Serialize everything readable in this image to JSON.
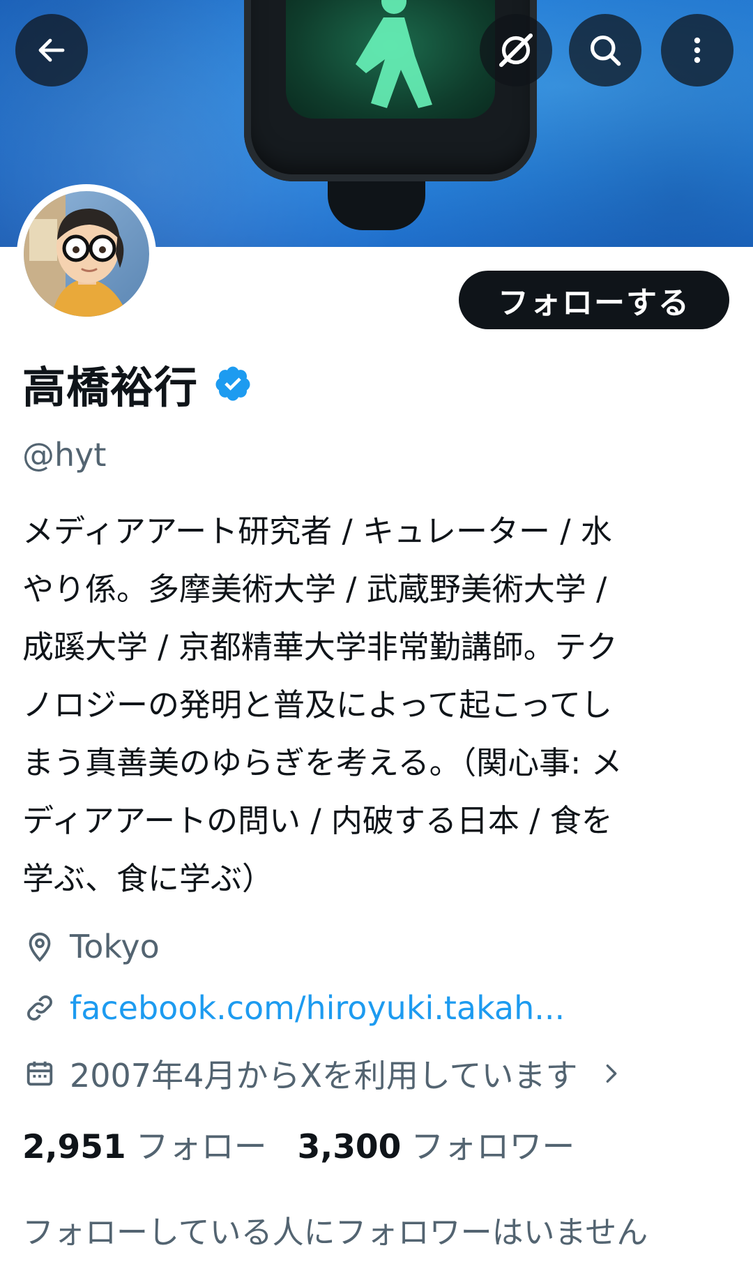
{
  "header": {
    "back_icon": "arrow-left-icon",
    "grok_icon": "grok-icon",
    "search_icon": "search-icon",
    "more_icon": "more-vertical-icon"
  },
  "profile": {
    "name": "高橋裕行",
    "handle": "@hyt",
    "verified": true,
    "follow_label": "フォローする",
    "bio_lines": [
      "メディアアート研究者 / キュレーター /  水",
      "やり係。多摩美術大学 / 武蔵野美術大学 /",
      "成蹊大学 / 京都精華大学非常勤講師。テク",
      "ノロジーの発明と普及によって起こってし",
      "まう真善美のゆらぎを考える。（関心事: メ",
      "ディアアートの問い  / 内破する日本 / 食を",
      "学ぶ、食に学ぶ）"
    ],
    "location": "Tokyo",
    "website": "facebook.com/hiroyuki.takah...",
    "joined": "2007年4月からXを利用しています",
    "following_count": "2,951",
    "following_label": "フォロー",
    "followers_count": "3,300",
    "followers_label": "フォロワー",
    "mutual_note": "フォローしている人にフォロワーはいません"
  },
  "colors": {
    "accent": "#1d9bf0",
    "text": "#0f1419",
    "secondary": "#536471",
    "button_bg": "#0f1419"
  }
}
